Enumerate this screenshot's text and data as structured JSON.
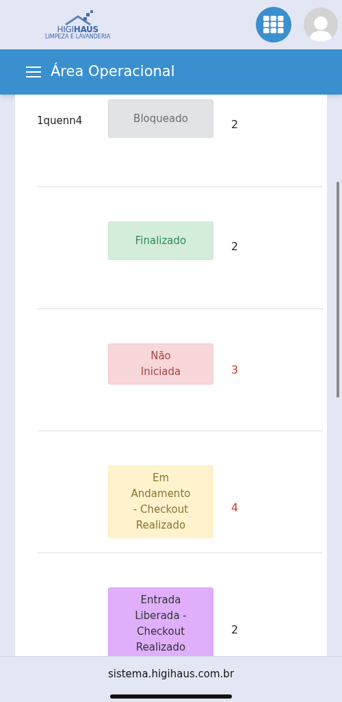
{
  "logo": {
    "name_light": "HIGI",
    "name_bold": "HAUS",
    "tagline": "LIMPEZA E LAVANDERIA"
  },
  "app_bar": {
    "title": "Área Operacional"
  },
  "rows": [
    {
      "name": "1quenn4",
      "status": {
        "kind": "blocked",
        "label": "Bloqueado"
      },
      "count": "2",
      "alert": false
    },
    {
      "status": {
        "kind": "done",
        "label": "Finalizado"
      },
      "count": "2",
      "alert": false
    },
    {
      "status": {
        "kind": "not_started",
        "label": "Não Iniciada"
      },
      "count": "3",
      "alert": true
    },
    {
      "status": {
        "kind": "in_progress",
        "label": "Em Andamento - Checkout Realizado"
      },
      "count": "4",
      "alert": true
    },
    {
      "status": {
        "kind": "released",
        "label": "Entrada Liberada - Checkout Realizado"
      },
      "count": "2",
      "alert": false
    }
  ],
  "browser": {
    "url": "sistema.higihaus.com.br"
  }
}
